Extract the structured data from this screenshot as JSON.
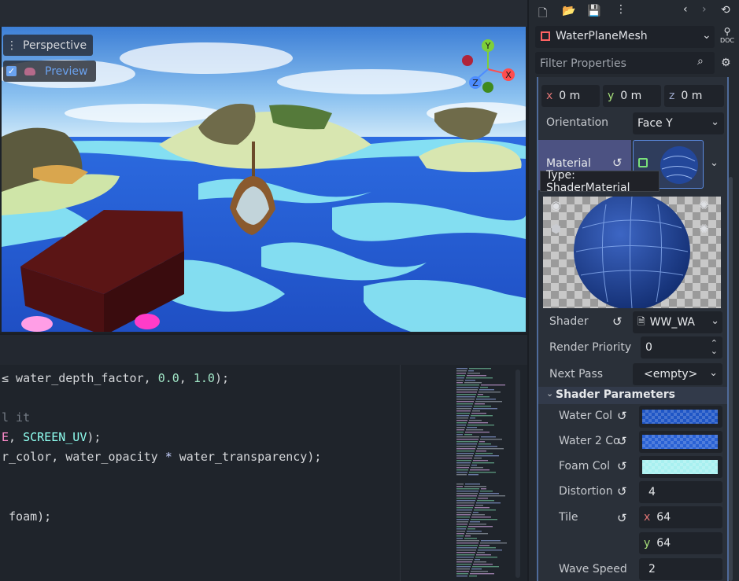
{
  "viewport": {
    "perspective_label": "Perspective",
    "preview_label": "Preview",
    "gizmo": {
      "x": "X",
      "y": "Y",
      "z": "Z"
    }
  },
  "code": {
    "lines": [
      {
        "segments": [
          {
            "t": "≤ water_depth_factor, ",
            "c": "fn"
          },
          {
            "t": "0.0",
            "c": "num"
          },
          {
            "t": ", ",
            "c": "fn"
          },
          {
            "t": "1.0",
            "c": "num"
          },
          {
            "t": ");",
            "c": "fn"
          }
        ]
      },
      {
        "segments": [
          {
            "t": "l it",
            "c": "cm"
          }
        ]
      },
      {
        "segments": [
          {
            "t": "E",
            "c": "kw"
          },
          {
            "t": ", ",
            "c": "fn"
          },
          {
            "t": "SCREEN_UV",
            "c": "type"
          },
          {
            "t": ");",
            "c": "fn"
          }
        ]
      },
      {
        "segments": [
          {
            "t": "r_color, water_opacity ",
            "c": "fn"
          },
          {
            "t": "*",
            "c": "sym"
          },
          {
            "t": " water_transparency);",
            "c": "fn"
          }
        ]
      },
      {
        "segments": [
          {
            "t": " foam);",
            "c": "fn"
          }
        ]
      }
    ]
  },
  "inspector": {
    "resource_name": "WaterPlaneMesh",
    "doc_label": "DOC",
    "filter_placeholder": "Filter Properties",
    "center_offset": {
      "x_label": "x",
      "x_value": "0 m",
      "y_label": "y",
      "y_value": "0 m",
      "z_label": "z",
      "z_value": "0 m"
    },
    "orientation": {
      "label": "Orientation",
      "value": "Face Y"
    },
    "material": {
      "label": "Material",
      "tooltip": "Type: ShaderMaterial"
    },
    "shader": {
      "label": "Shader",
      "value": "WW_WA"
    },
    "render_priority": {
      "label": "Render Priority",
      "value": "0"
    },
    "next_pass": {
      "label": "Next Pass",
      "value": "<empty>"
    },
    "shader_parameters": {
      "title": "Shader Parameters",
      "water_col": {
        "label": "Water Col",
        "color": "#1f56c6"
      },
      "water2_col": {
        "label": "Water 2 Co",
        "color": "#2961d4"
      },
      "foam_col": {
        "label": "Foam Col",
        "color": "#a8f0f0"
      },
      "distortion": {
        "label": "Distortion",
        "value": "4"
      },
      "tile": {
        "label": "Tile",
        "x_label": "x",
        "x_value": "64",
        "y_label": "y",
        "y_value": "64"
      },
      "wave_speed": {
        "label": "Wave Speed",
        "value": "2"
      }
    }
  }
}
